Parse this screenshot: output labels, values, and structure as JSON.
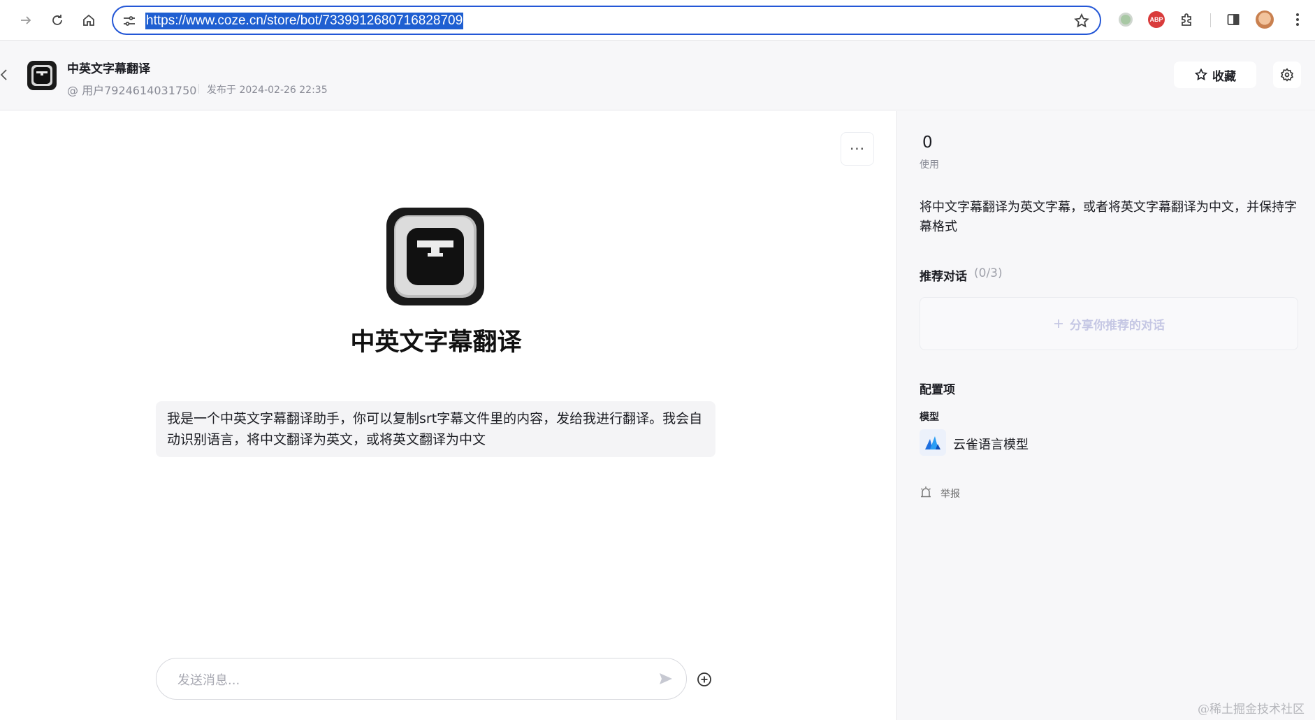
{
  "browser": {
    "url": "https://www.coze.cn/store/bot/7339912680716828709",
    "extensions": {
      "abp_label": "ABP"
    }
  },
  "header": {
    "bot_title": "中英文字幕翻译",
    "author": "@ 用户7924614031750",
    "publish_time": "发布于 2024-02-26 22:35",
    "favorite_label": "收藏"
  },
  "chat": {
    "bot_name": "中英文字幕翻译",
    "more_label": "···",
    "intro_message": "我是一个中英文字幕翻译助手，你可以复制srt字幕文件里的内容，发给我进行翻译。我会自动识别语言，将中文翻译为英文，或将英文翻译为中文",
    "input_placeholder": "发送消息..."
  },
  "sidebar": {
    "usage_count": "0",
    "usage_label": "使用",
    "description": "将中文字幕翻译为英文字幕，或者将英文字幕翻译为中文，并保持字幕格式",
    "recommended_title": "推荐对话",
    "recommended_count": "(0/3)",
    "share_recommended": "分享你推荐的对话",
    "config_title": "配置项",
    "model_label": "模型",
    "model_name": "云雀语言模型",
    "report_label": "举报"
  },
  "watermark": "@稀土掘金技术社区",
  "colors": {
    "accent": "#2457d6",
    "url_highlight": "#1f5fd1",
    "sidebar_bg": "#f7f7f9",
    "bubble_bg": "#f4f4f6"
  },
  "icons": [
    "forward-icon",
    "reload-icon",
    "home-icon",
    "site-info-icon",
    "star-icon",
    "puzzle-icon",
    "side-panel-icon",
    "menu-icon",
    "back-icon",
    "settings-icon",
    "send-icon",
    "add-icon",
    "plus-icon",
    "model-icon",
    "report-icon"
  ]
}
